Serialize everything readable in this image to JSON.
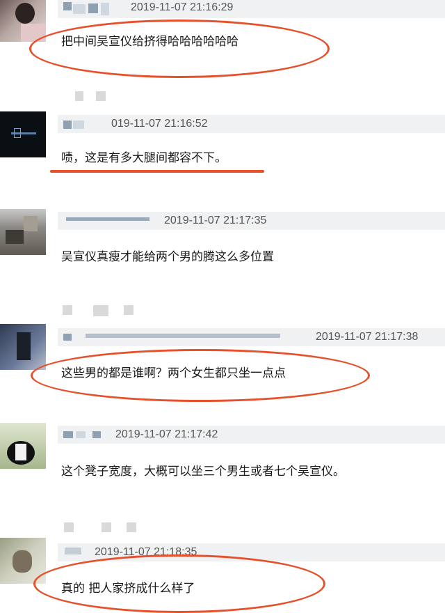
{
  "comments": [
    {
      "timestamp": "2019-11-07 21:16:29",
      "text": "把中间吴宣仪给挤得哈哈哈哈哈哈"
    },
    {
      "timestamp": "019-11-07 21:16:52",
      "text": "啧，这是有多大腿间都容不下。"
    },
    {
      "timestamp": "2019-11-07 21:17:35",
      "text": "吴宣仪真瘦才能给两个男的腾这么多位置"
    },
    {
      "timestamp": "2019-11-07 21:17:38",
      "text": "这些男的都是谁啊？两个女生都只坐一点点"
    },
    {
      "timestamp": "2019-11-07 21:17:42",
      "text": "这个凳子宽度，大概可以坐三个男生或者七个吴宣仪。"
    },
    {
      "timestamp": "2019-11-07 21:18:35",
      "text": "真的 把人家挤成什么样了"
    }
  ],
  "colors": {
    "annotation": "#e6502a",
    "header_bg": "#f0f1f2",
    "text": "#1a1a1a"
  }
}
